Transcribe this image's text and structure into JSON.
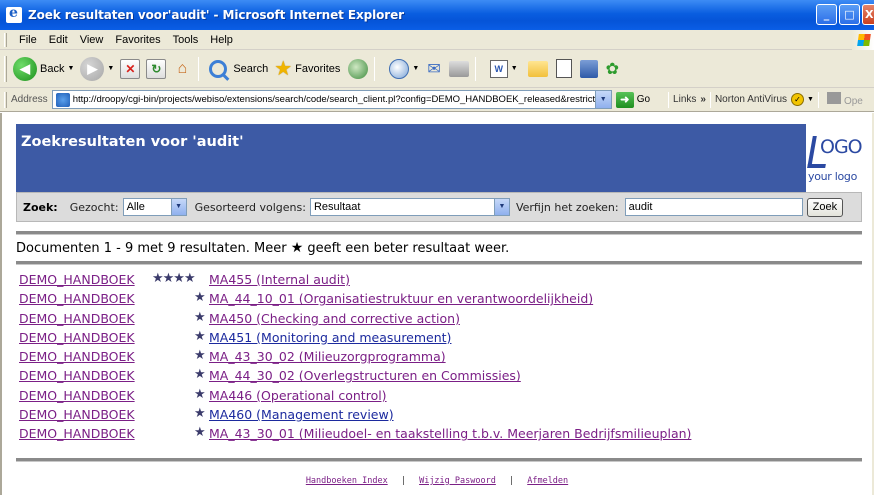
{
  "window": {
    "title": "Zoek resultaten voor'audit' - Microsoft Internet Explorer"
  },
  "menu": [
    "File",
    "Edit",
    "View",
    "Favorites",
    "Tools",
    "Help"
  ],
  "toolbar": {
    "back_label": "Back",
    "search_label": "Search",
    "favorites_label": "Favorites"
  },
  "address": {
    "label": "Address",
    "url": "http://droopy/cgi-bin/projects/webiso/extensions/search/code/search_client.pl?config=DEMO_HANDBOEK_released&restrict",
    "go_label": "Go",
    "links_label": "Links",
    "links_chevron": "»",
    "norton_label": "Norton AntiVirus",
    "opera_label": "Ope"
  },
  "page": {
    "header_title": "Zoekresultaten voor 'audit'",
    "logo": {
      "mark": "OGO",
      "sub": "your logo"
    },
    "search": {
      "zoek_label": "Zoek:",
      "searched_label": "Gezocht:",
      "searched_value": "Alle",
      "sort_label": "Gesorteerd volgens:",
      "sort_value": "Resultaat",
      "refine_label": "Verfijn het zoeken:",
      "refine_value": "audit",
      "button_label": "Zoek"
    },
    "summary": {
      "before": "Documenten 1 - 9 met 9 resultaten. Meer ",
      "star": "★",
      "after": " geeft een beter resultaat weer."
    },
    "results": [
      {
        "source": "DEMO_HANDBOEK",
        "stars": "★★★★",
        "title": "MA455 (Internal audit)",
        "visited": true
      },
      {
        "source": "DEMO_HANDBOEK",
        "stars": "★",
        "title": "MA_44_10_01 (Organisatiestruktuur en verantwoordelijkheid)",
        "visited": true
      },
      {
        "source": "DEMO_HANDBOEK",
        "stars": "★",
        "title": "MA450 (Checking and corrective action)",
        "visited": true
      },
      {
        "source": "DEMO_HANDBOEK",
        "stars": "★",
        "title": "MA451 (Monitoring and measurement)",
        "visited": false
      },
      {
        "source": "DEMO_HANDBOEK",
        "stars": "★",
        "title": "MA_43_30_02 (Milieuzorgprogramma)",
        "visited": true
      },
      {
        "source": "DEMO_HANDBOEK",
        "stars": "★",
        "title": "MA_44_30_02 (Overlegstructuren en Commissies)",
        "visited": true
      },
      {
        "source": "DEMO_HANDBOEK",
        "stars": "★",
        "title": "MA446 (Operational control)",
        "visited": true
      },
      {
        "source": "DEMO_HANDBOEK",
        "stars": "★",
        "title": "MA460 (Management review)",
        "visited": false
      },
      {
        "source": "DEMO_HANDBOEK",
        "stars": "★",
        "title": "MA_43_30_01 (Milieudoel- en taakstelling t.b.v. Meerjaren Bedrijfsmilieuplan)",
        "visited": true
      }
    ],
    "footer": {
      "index": "Handboeken Index",
      "sep1": "|",
      "password": "Wijzig Paswoord",
      "sep2": "|",
      "logout": "Afmelden"
    }
  },
  "colors": {
    "header_band": "#3d5aa5",
    "visited_link": "#7b1f86",
    "unvisited_link": "#1c2a9e"
  }
}
